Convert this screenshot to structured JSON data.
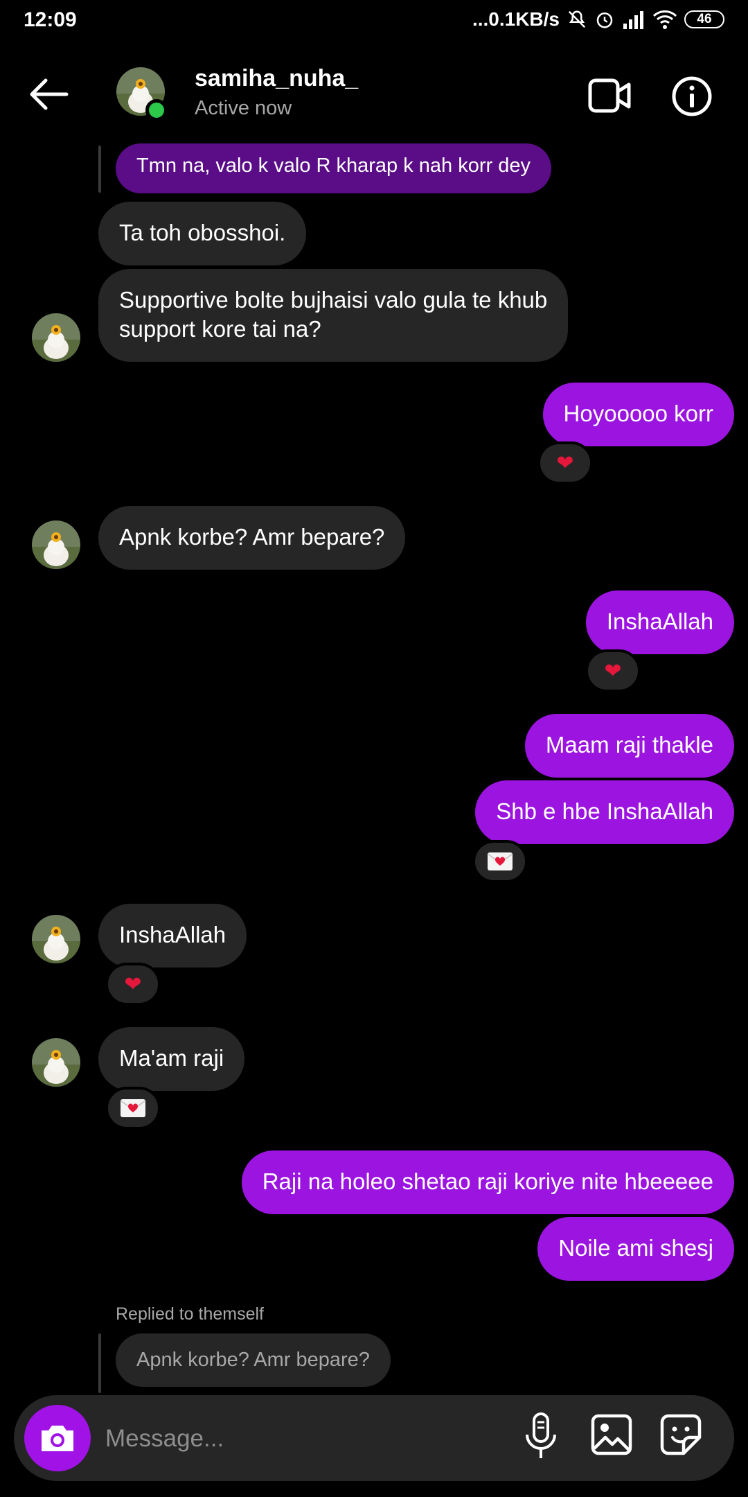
{
  "status_bar": {
    "time": "12:09",
    "network": "...0.1KB/s",
    "battery": "46"
  },
  "header": {
    "name": "samiha_nuha_",
    "status": "Active now",
    "online_color": "#2cc84a"
  },
  "colors": {
    "sent_bubble": "#9b14e0",
    "received_bubble": "#262626",
    "reply_quote": "#5a0d87",
    "heart": "#e5173b"
  },
  "messages": {
    "m0_reply_quote": "Tmn na, valo k valo R kharap k nah korr dey",
    "m1": "Ta toh obosshoi.",
    "m2_line1": "Supportive bolte bujhaisi valo gula te khub",
    "m2_line2": "support kore tai na?",
    "m3": "Hoyooooo korr",
    "m4": "Apnk korbe? Amr bepare?",
    "m5": "InshaAllah",
    "m6": "Maam raji thakle",
    "m7": "Shb e hbe InshaAllah",
    "m8": "InshaAllah",
    "m9": "Ma'am raji",
    "m10": "Raji na holeo shetao raji koriye nite hbeeeee",
    "m11": "Noile ami shesj"
  },
  "reactions": {
    "heart": "❤",
    "love_letter_icon": "love-letter"
  },
  "reply_preview": {
    "label": "Replied to themself",
    "text": "Apnk korbe? Amr bepare?"
  },
  "composer": {
    "placeholder": "Message..."
  }
}
